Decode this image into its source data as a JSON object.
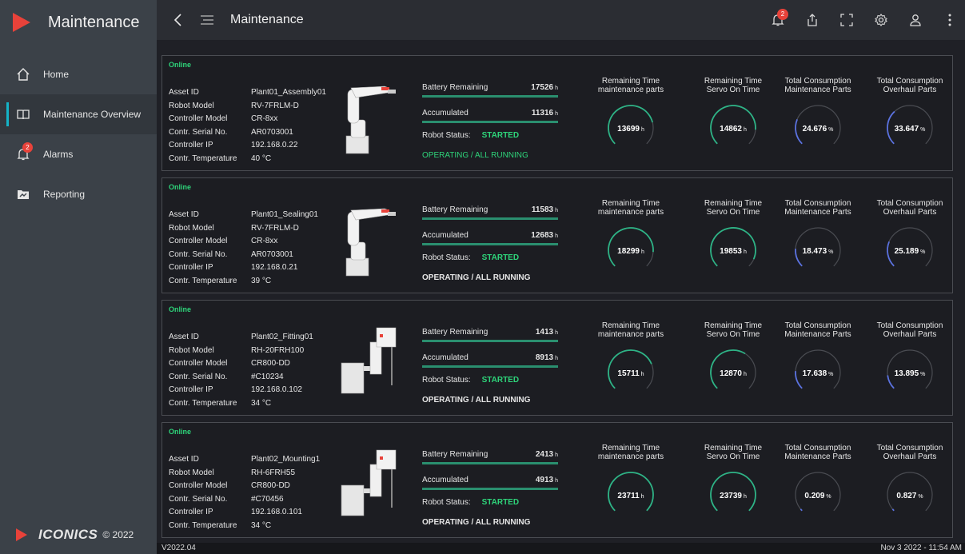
{
  "app": {
    "brand_title": "Maintenance",
    "page_title": "Maintenance",
    "footer_brand": "ICONICS",
    "footer_copyright": "© 2022",
    "version": "V2022.04",
    "timestamp": "Nov 3 2022 - 11:54 AM",
    "notification_count": "2",
    "accent_color": "#2ed47a",
    "brand_color": "#e8423a"
  },
  "sidebar": {
    "items": [
      {
        "label": "Home",
        "icon": "home-icon"
      },
      {
        "label": "Maintenance Overview",
        "icon": "book-icon",
        "active": true
      },
      {
        "label": "Alarms",
        "icon": "bell-icon",
        "badge": "2"
      },
      {
        "label": "Reporting",
        "icon": "folder-chart-icon"
      }
    ]
  },
  "labels": {
    "online": "Online",
    "asset_id": "Asset ID",
    "robot_model": "Robot Model",
    "controller_model": "Controller Model",
    "serial": "Contr. Serial No.",
    "ip": "Controller IP",
    "temp": "Contr. Temperature",
    "battery": "Battery Remaining",
    "accumulated": "Accumulated",
    "robot_status": "Robot Status:",
    "unit_h": "h",
    "unit_pct": "%",
    "g1_title": "Remaining Time maintenance parts",
    "g2_title": "Remaining Time Servo On Time",
    "g3_title": "Total Consumption Maintenance Parts",
    "g4_title": "Total Consumption Overhaul Parts"
  },
  "robots": [
    {
      "asset_id": "Plant01_Assembly01",
      "robot_model": "RV-7FRLM-D",
      "controller_model": "CR-8xx",
      "serial": "AR0703001",
      "ip": "192.168.0.22",
      "temp": "40 °C",
      "battery": "17526",
      "accumulated": "11316",
      "status": "STARTED",
      "operating": "OPERATING / ALL RUNNING",
      "operating_green": true,
      "type": "arm",
      "g1": "13699",
      "g2": "14862",
      "g3": "24.676",
      "g4": "33.647",
      "g1_frac": 0.78,
      "g2_frac": 0.85,
      "g3_frac": 0.25,
      "g4_frac": 0.34
    },
    {
      "asset_id": "Plant01_Sealing01",
      "robot_model": "RV-7FRLM-D",
      "controller_model": "CR-8xx",
      "serial": "AR0703001",
      "ip": "192.168.0.21",
      "temp": "39 °C",
      "battery": "11583",
      "accumulated": "12683",
      "status": "STARTED",
      "operating": "OPERATING / ALL RUNNING",
      "operating_green": false,
      "type": "arm",
      "g1": "18299",
      "g2": "19853",
      "g3": "18.473",
      "g4": "25.189",
      "g1_frac": 0.85,
      "g2_frac": 0.92,
      "g3_frac": 0.18,
      "g4_frac": 0.25
    },
    {
      "asset_id": "Plant02_Fitting01",
      "robot_model": "RH-20FRH100",
      "controller_model": "CR800-DD",
      "serial": "#C10234",
      "ip": "192.168.0.102",
      "temp": "34 °C",
      "battery": "1413",
      "accumulated": "8913",
      "status": "STARTED",
      "operating": "OPERATING / ALL RUNNING",
      "operating_green": false,
      "type": "scara",
      "g1": "15711",
      "g2": "12870",
      "g3": "17.638",
      "g4": "13.895",
      "g1_frac": 0.75,
      "g2_frac": 0.62,
      "g3_frac": 0.18,
      "g4_frac": 0.14
    },
    {
      "asset_id": "Plant02_Mounting1",
      "robot_model": "RH-6FRH55",
      "controller_model": "CR800-DD",
      "serial": "#C70456",
      "ip": "192.168.0.101",
      "temp": "34 °C",
      "battery": "2413",
      "accumulated": "4913",
      "status": "STARTED",
      "operating": "OPERATING / ALL RUNNING",
      "operating_green": false,
      "type": "scara",
      "g1": "23711",
      "g2": "23739",
      "g3": "0.209",
      "g4": "0.827",
      "g1_frac": 1.0,
      "g2_frac": 1.0,
      "g3_frac": 0.01,
      "g4_frac": 0.02
    }
  ]
}
